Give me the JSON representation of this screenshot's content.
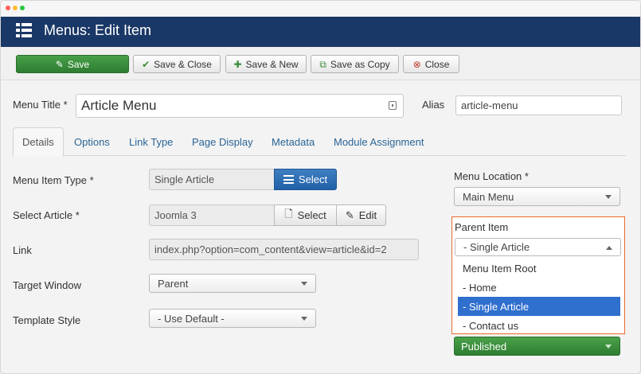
{
  "header": {
    "title": "Menus: Edit Item",
    "icon": "list-menu-icon"
  },
  "toolbar": {
    "save": "Save",
    "save_close": "Save & Close",
    "save_new": "Save & New",
    "save_copy": "Save as Copy",
    "close": "Close"
  },
  "form": {
    "menu_title_label": "Menu Title *",
    "menu_title_value": "Article Menu",
    "alias_label": "Alias",
    "alias_value": "article-menu"
  },
  "tabs": [
    "Details",
    "Options",
    "Link Type",
    "Page Display",
    "Metadata",
    "Module Assignment"
  ],
  "details": {
    "menu_item_type_label": "Menu Item Type *",
    "menu_item_type_value": "Single Article",
    "select_button": "Select",
    "select_article_label": "Select Article *",
    "select_article_value": "Joomla 3",
    "article_select_button": "Select",
    "article_edit_button": "Edit",
    "link_label": "Link",
    "link_value": "index.php?option=com_content&view=article&id=2",
    "target_window_label": "Target Window",
    "target_window_value": "Parent",
    "template_style_label": "Template Style",
    "template_style_value": "- Use Default -"
  },
  "sidebar": {
    "menu_location_label": "Menu Location *",
    "menu_location_value": "Main Menu",
    "parent_item_label": "Parent Item",
    "parent_item_value": "- Single Article",
    "parent_options": [
      "Menu Item Root",
      "- Home",
      "- Single Article",
      "- Contact us"
    ],
    "status_value": "Published"
  },
  "colors": {
    "header_bg": "#1a3867",
    "save_green": "#3a8f3c",
    "select_blue": "#2a68ad",
    "highlight_orange": "#e96b2c",
    "selected_option": "#2f6fce"
  }
}
